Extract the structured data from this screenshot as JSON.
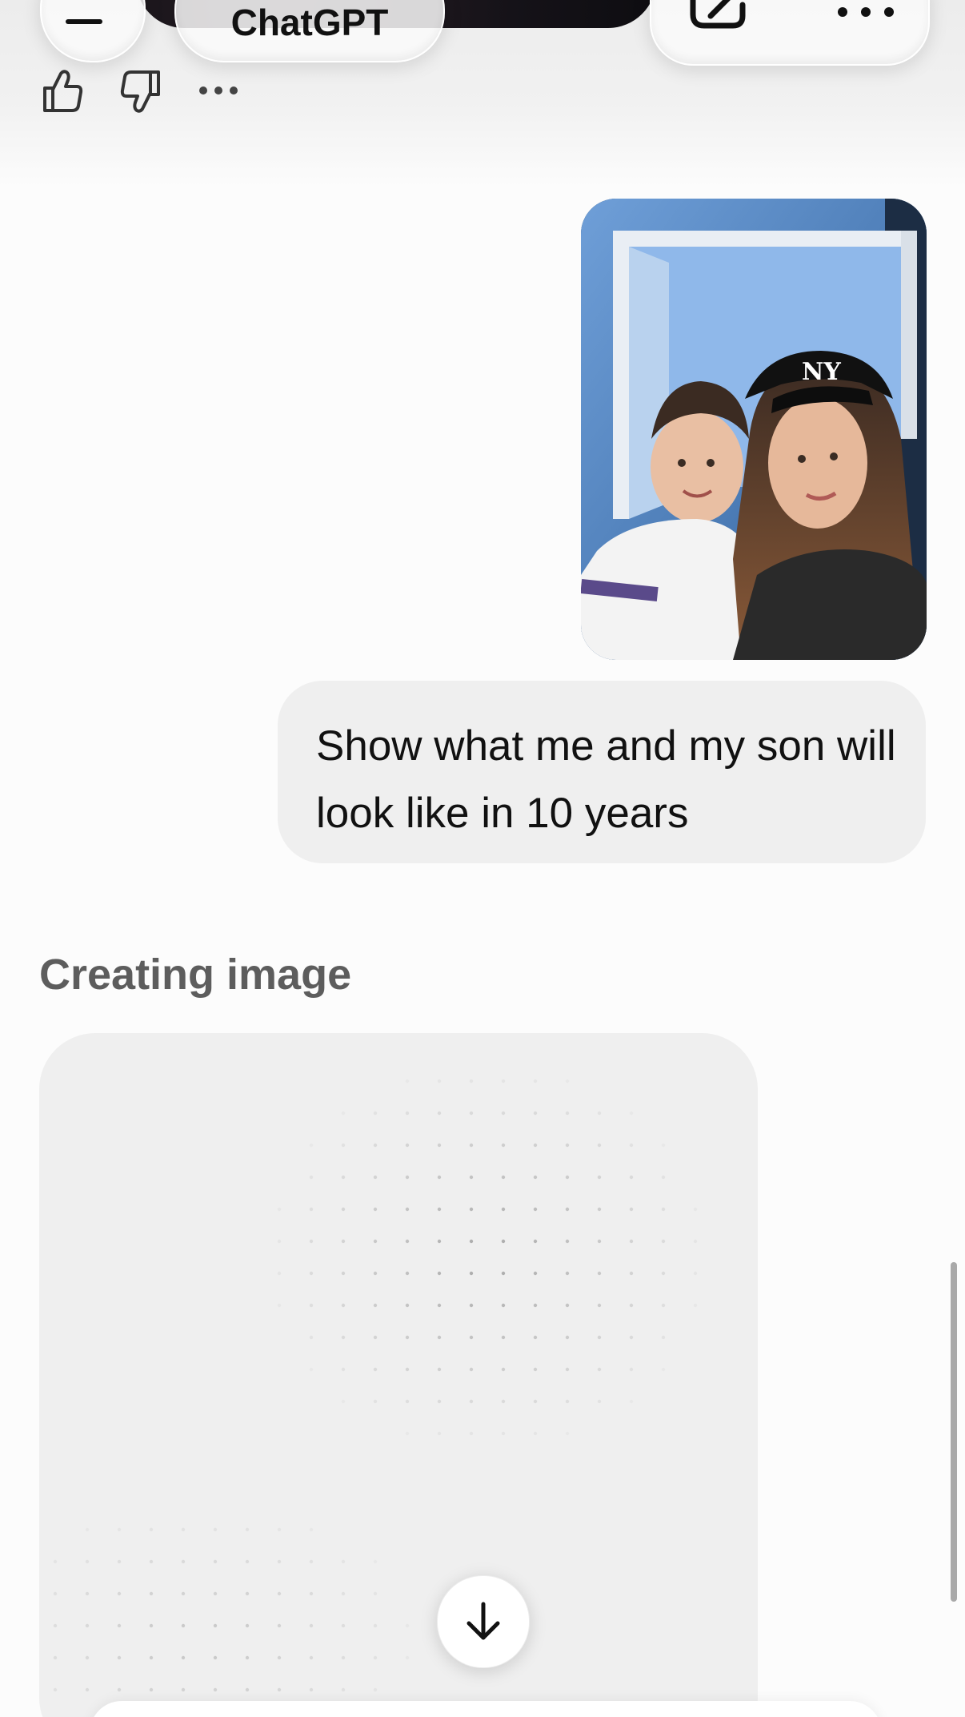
{
  "header": {
    "title": "ChatGPT",
    "menu_icon": "menu-icon",
    "edit_icon": "edit-icon",
    "more_icon": "more-icon"
  },
  "feedback": {
    "thumbs_up_icon": "thumbs-up-icon",
    "thumbs_down_icon": "thumbs-down-icon",
    "more_icon": "more-icon"
  },
  "conversation": {
    "user_message": "Show what me and my son will look like in 10 years",
    "status": "Creating image"
  },
  "controls": {
    "scroll_down_icon": "arrow-down-icon"
  }
}
